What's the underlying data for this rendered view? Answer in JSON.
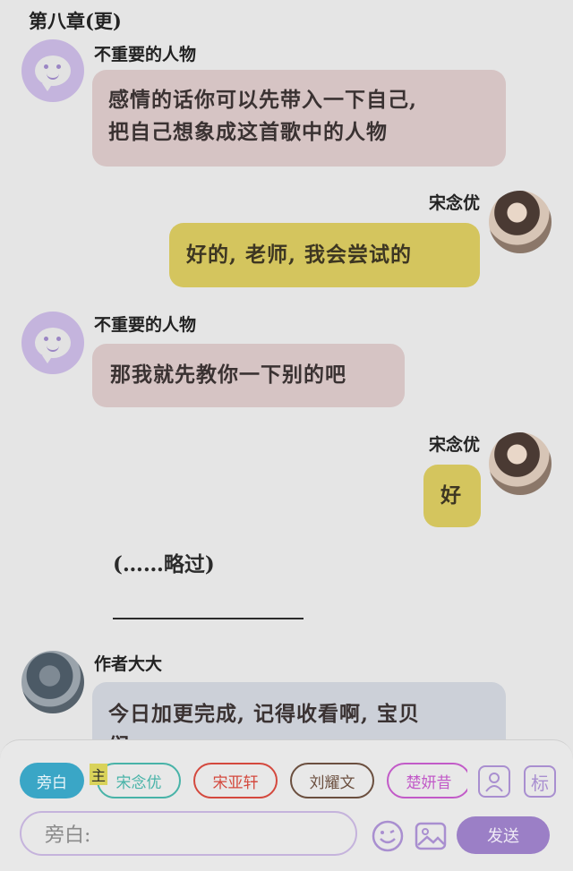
{
  "header": {
    "title": "第八章(更)"
  },
  "messages": [
    {
      "speaker": "不重要的人物",
      "text_lines": [
        "感情的话你可以先带入一下自己,",
        "把自己想象成这首歌中的人物"
      ]
    },
    {
      "speaker": "宋念优",
      "text": "好的, 老师, 我会尝试的"
    },
    {
      "speaker": "不重要的人物",
      "text": "那我就先教你一下别的吧"
    },
    {
      "speaker": "宋念优",
      "text": "好"
    },
    {
      "narration": "(……略过)"
    },
    {
      "speaker": "作者大大",
      "text_lines": [
        "今日加更完成, 记得收看啊, 宝贝",
        "们"
      ]
    }
  ],
  "character_tabs": [
    {
      "label": "旁白",
      "color": "#3aa6c6",
      "selected": true
    },
    {
      "label": "宋念优",
      "color": "#48b3a8",
      "selected": false
    },
    {
      "label": "宋亚轩",
      "color": "#d4493e",
      "selected": false
    },
    {
      "label": "刘耀文",
      "color": "#6b4f3f",
      "selected": false
    },
    {
      "label": "楚妍昔",
      "color": "#c25bc8",
      "selected": false
    }
  ],
  "main_marker": "主",
  "input": {
    "placeholder": "旁白:"
  },
  "send_button": {
    "label": "发送"
  },
  "icons": {
    "character_icon": "person-icon",
    "tag_icon": "标",
    "emoji_icon": "smiley-icon",
    "image_icon": "image-icon"
  },
  "colors": {
    "accent": "#9b7fc6",
    "right_bubble": "#d4c55e",
    "left_bubble": "#d6c4c4"
  }
}
